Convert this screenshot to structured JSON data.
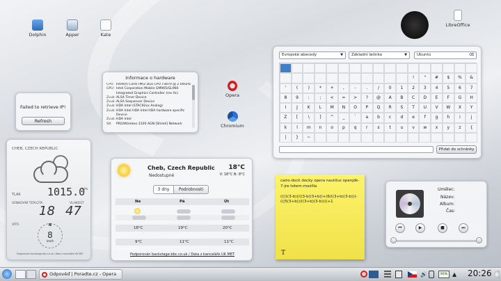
{
  "desktop_icons": [
    {
      "label": "Dolphin"
    },
    {
      "label": "Apper"
    },
    {
      "label": "Kate"
    },
    {
      "label": "LibreOffice"
    },
    {
      "label": "Opera"
    },
    {
      "label": "Chromium"
    }
  ],
  "ip_widget": {
    "message": "Failed to retrieve IP!",
    "refresh": "Refresh"
  },
  "hw_widget": {
    "title": "Informace o hardware",
    "rows": [
      {
        "k": "CPU:",
        "v": "Intel(R) Core(TM)2 Duo CPU T5870 @ 2.00GHz"
      },
      {
        "k": "GPU:",
        "v": "Intel Corporation Mobile GM965/GL960 Integrated Graphics Controller (rev 0c)"
      },
      {
        "k": "Zvuk:",
        "v": "ALSA Timer Device"
      },
      {
        "k": "Zvuk:",
        "v": "ALSA Sequencer Device"
      },
      {
        "k": "Zvuk:",
        "v": "HDA Intel (STAC92xx Analog)"
      },
      {
        "k": "Zvuk:",
        "v": "HDA Intel HDA Intel HDA hardware specific Device"
      },
      {
        "k": "Zvuk:",
        "v": "HDA Intel"
      },
      {
        "k": "Síť:",
        "v": "PRO/Wireless 3100 AGN [Shiloh] Network"
      }
    ]
  },
  "charselect": {
    "block": "Evropské abecedy",
    "subset": "Základní latinka",
    "font": "Ubuntu",
    "rows": [
      [
        "",
        "",
        "",
        "",
        "",
        "",
        "",
        "",
        "",
        "",
        "",
        "",
        "",
        ""
      ],
      [
        "",
        "",
        "",
        "",
        "",
        "",
        "",
        "",
        "",
        "",
        "",
        "!",
        "\"",
        "#",
        "$",
        "%",
        "&"
      ],
      [
        "'",
        "(",
        ")",
        "*",
        "+",
        ",",
        "-",
        ".",
        "/",
        "0",
        "1",
        "2",
        "3",
        "4",
        "5",
        "6",
        "7"
      ],
      [
        "8",
        "9",
        ":",
        ";",
        "<",
        "=",
        ">",
        "?",
        "@",
        "A",
        "B",
        "C",
        "D",
        "E",
        "F",
        "G",
        "H"
      ],
      [
        "I",
        "J",
        "K",
        "L",
        "M",
        "N",
        "O",
        "P",
        "Q",
        "R",
        "S",
        "T",
        "U",
        "V",
        "W",
        "X",
        "Y"
      ],
      [
        "Z",
        "[",
        "\\",
        "]",
        "^",
        "_",
        "`",
        "a",
        "b",
        "c",
        "d",
        "e",
        "f",
        "g",
        "h",
        "i",
        "j"
      ],
      [
        "k",
        "l",
        "m",
        "n",
        "o",
        "p",
        "q",
        "r",
        "s",
        "t",
        "u",
        "v",
        "w",
        "x",
        "y",
        "z",
        "{"
      ],
      [
        "|",
        "}",
        "~",
        "",
        "",
        "",
        "",
        "",
        "",
        "",
        "",
        "",
        "",
        "",
        "",
        "",
        ""
      ]
    ],
    "add_label": "Přidat do schránky"
  },
  "weather_left": {
    "location": "CHEB, CZECH REPUBLIC",
    "pressure_label": "TLAK",
    "pressure": "1015.0",
    "pressure_unit": "hPa",
    "temp_label": "VENKOVNÍ TEPLOTA",
    "humidity_label": "VLHKOST",
    "temp": "18",
    "humidity": "47",
    "wind_label": "VÍTR",
    "wind": "8",
    "wind_unit": "km/h",
    "wind_dir": "N",
    "credit": "Podporován backstage.bbc.co.uk / Data z kanceláře UK MET"
  },
  "weather_main": {
    "location": "Cheb, Czech Republic",
    "condition": "Nedostupné",
    "temp": "18°C",
    "wind": "V: 18°C N: 8°C",
    "tab_days": "3 dny",
    "tab_details": "Podrobnosti",
    "days": [
      "Ne",
      "Pá",
      "Út"
    ],
    "highs": [
      "18°C",
      "19°C",
      "20°C"
    ],
    "lows": [
      "9°C",
      "11°C",
      "11°C"
    ],
    "credit": "Podporován backstage.bbc.co.uk / Data z kanceláře UK MET"
  },
  "note": {
    "text": "cairo-dock docky opera nautilus openjdk-7-jre totem-mozilla\n\n(((1(3-b))/((3-b)(3+b))+(6/((3+b)(3-b)))-(((5(3+b))/((3+b)(3-b))))+1",
    "icon": "T"
  },
  "player": {
    "artist_label": "Umělec:",
    "title_label": "Název:",
    "album_label": "Album:",
    "time_label": "Čas:"
  },
  "taskbar": {
    "task_label": "Odpověď | Poradte.cz - Opera",
    "battery": "91%",
    "clock": "20:26",
    "lang": "cs"
  }
}
